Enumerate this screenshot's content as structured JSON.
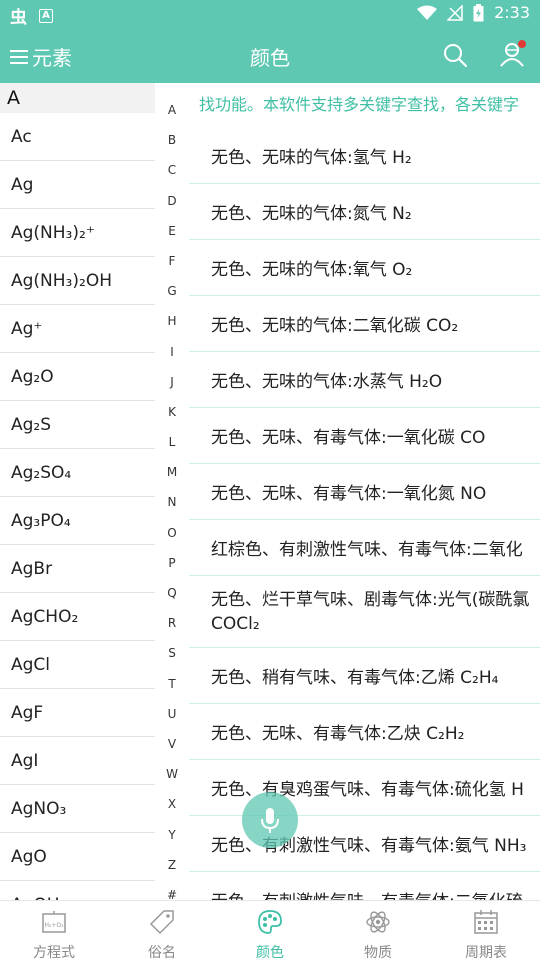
{
  "status_bar": {
    "time": "2:33",
    "app_glyph": "虫",
    "notification_glyph": "A"
  },
  "app_bar": {
    "menu_label": "元素",
    "title": "颜色",
    "icons": [
      "search-icon",
      "user-icon"
    ]
  },
  "left_list": {
    "section": "A",
    "items": [
      "Ac",
      "Ag",
      "Ag(NH₃)₂⁺",
      "Ag(NH₃)₂OH",
      "Ag⁺",
      "Ag₂O",
      "Ag₂S",
      "Ag₂SO₄",
      "Ag₃PO₄",
      "AgBr",
      "AgCHO₂",
      "AgCl",
      "AgF",
      "AgI",
      "AgNO₃",
      "AgO",
      "AgOH"
    ]
  },
  "index_letters": [
    "A",
    "B",
    "C",
    "D",
    "E",
    "F",
    "G",
    "H",
    "I",
    "J",
    "K",
    "L",
    "M",
    "N",
    "O",
    "P",
    "Q",
    "R",
    "S",
    "T",
    "U",
    "V",
    "W",
    "X",
    "Y",
    "Z",
    "#"
  ],
  "marquee": "找功能。本软件支持多关键字查找，各关键字",
  "color_items": [
    {
      "lines": [
        "无色、无味的气体:氢气 H₂"
      ]
    },
    {
      "lines": [
        "无色、无味的气体:氮气 N₂"
      ]
    },
    {
      "lines": [
        "无色、无味的气体:氧气 O₂"
      ]
    },
    {
      "lines": [
        "无色、无味的气体:二氧化碳 CO₂"
      ]
    },
    {
      "lines": [
        "无色、无味的气体:水蒸气 H₂O"
      ]
    },
    {
      "lines": [
        "无色、无味、有毒气体:一氧化碳 CO"
      ]
    },
    {
      "lines": [
        "无色、无味、有毒气体:一氧化氮 NO"
      ]
    },
    {
      "lines": [
        "红棕色、有刺激性气味、有毒气体:二氧化"
      ]
    },
    {
      "lines": [
        "无色、烂干草气味、剧毒气体:光气(碳酰氯",
        "COCl₂"
      ]
    },
    {
      "lines": [
        "无色、稍有气味、有毒气体:乙烯 C₂H₄"
      ]
    },
    {
      "lines": [
        "无色、无味、有毒气体:乙炔 C₂H₂"
      ]
    },
    {
      "lines": [
        "无色、有臭鸡蛋气味、有毒气体:硫化氢 H"
      ]
    },
    {
      "lines": [
        "无色、有刺激性气味、有毒气体:氨气 NH₃"
      ]
    },
    {
      "lines": [
        "无色、有刺激性气味、有毒气体:二氧化硫"
      ]
    }
  ],
  "bottom_nav": [
    {
      "label": "方程式",
      "icon": "equation-icon"
    },
    {
      "label": "俗名",
      "icon": "tag-icon"
    },
    {
      "label": "颜色",
      "icon": "palette-icon",
      "active": true
    },
    {
      "label": "物质",
      "icon": "atom-icon"
    },
    {
      "label": "周期表",
      "icon": "table-icon"
    }
  ],
  "colors": {
    "primary": "#5fc8b2",
    "accent_text": "#3fbfa4",
    "badge": "#e53935"
  }
}
